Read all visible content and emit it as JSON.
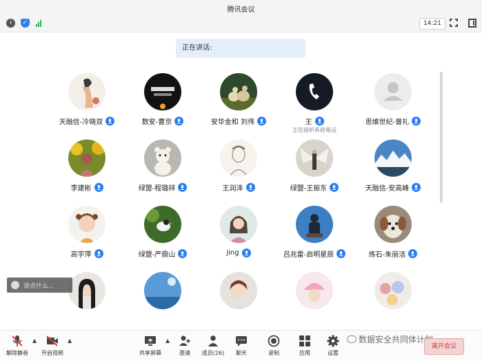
{
  "window": {
    "title": "腾讯会议"
  },
  "infobar": {
    "time": "14:21"
  },
  "speaking": {
    "label": "正在讲话:"
  },
  "participants": [
    {
      "name": "天融信-冷晓双",
      "avatar": "ink-lady",
      "status": ""
    },
    {
      "name": "数安-曹京",
      "avatar": "dark-badge",
      "status": ""
    },
    {
      "name": "安华金和 刘伟",
      "avatar": "sheep",
      "status": ""
    },
    {
      "name": "王",
      "avatar": "phone",
      "status": "正在接听系统电话"
    },
    {
      "name": "思维世纪-曾礼",
      "avatar": "default",
      "status": ""
    },
    {
      "name": "李建彬",
      "avatar": "yellow-flowers",
      "status": ""
    },
    {
      "name": "绿盟-程璐祥",
      "avatar": "teddy",
      "status": ""
    },
    {
      "name": "王润泽",
      "avatar": "sketch",
      "status": ""
    },
    {
      "name": "绿盟-王振东",
      "avatar": "wings",
      "status": ""
    },
    {
      "name": "天融信-安高峰",
      "avatar": "mountain",
      "status": ""
    },
    {
      "name": "高宇萍",
      "avatar": "cartoon-girl",
      "status": ""
    },
    {
      "name": "绿盟-严鼎山",
      "avatar": "bird",
      "status": ""
    },
    {
      "name": "jing",
      "avatar": "pink-girl",
      "status": ""
    },
    {
      "name": "吕兆雷-启明星辰",
      "avatar": "blue-man",
      "status": ""
    },
    {
      "name": "炼石-朱丽洁",
      "avatar": "dog",
      "status": ""
    },
    {
      "name": "",
      "avatar": "girl",
      "status": ""
    },
    {
      "name": "",
      "avatar": "sky",
      "status": ""
    },
    {
      "name": "",
      "avatar": "anime",
      "status": ""
    },
    {
      "name": "",
      "avatar": "pink-hat",
      "status": ""
    },
    {
      "name": "",
      "avatar": "toys",
      "status": ""
    }
  ],
  "chat": {
    "placeholder": "说点什么..."
  },
  "toolbar": {
    "unmute": "解除静音",
    "start_video": "开启视频",
    "share_screen": "共享屏幕",
    "invite": "邀请",
    "members": "成员(26)",
    "chat": "聊天",
    "record": "录制",
    "apps": "应用",
    "settings": "设置",
    "leave": "离开会议"
  },
  "watermark": {
    "text": "数据安全共同体计划"
  },
  "colors": {
    "accent": "#2d7ff0",
    "leave": "#d23b3b",
    "signal": "#2fb34a"
  }
}
